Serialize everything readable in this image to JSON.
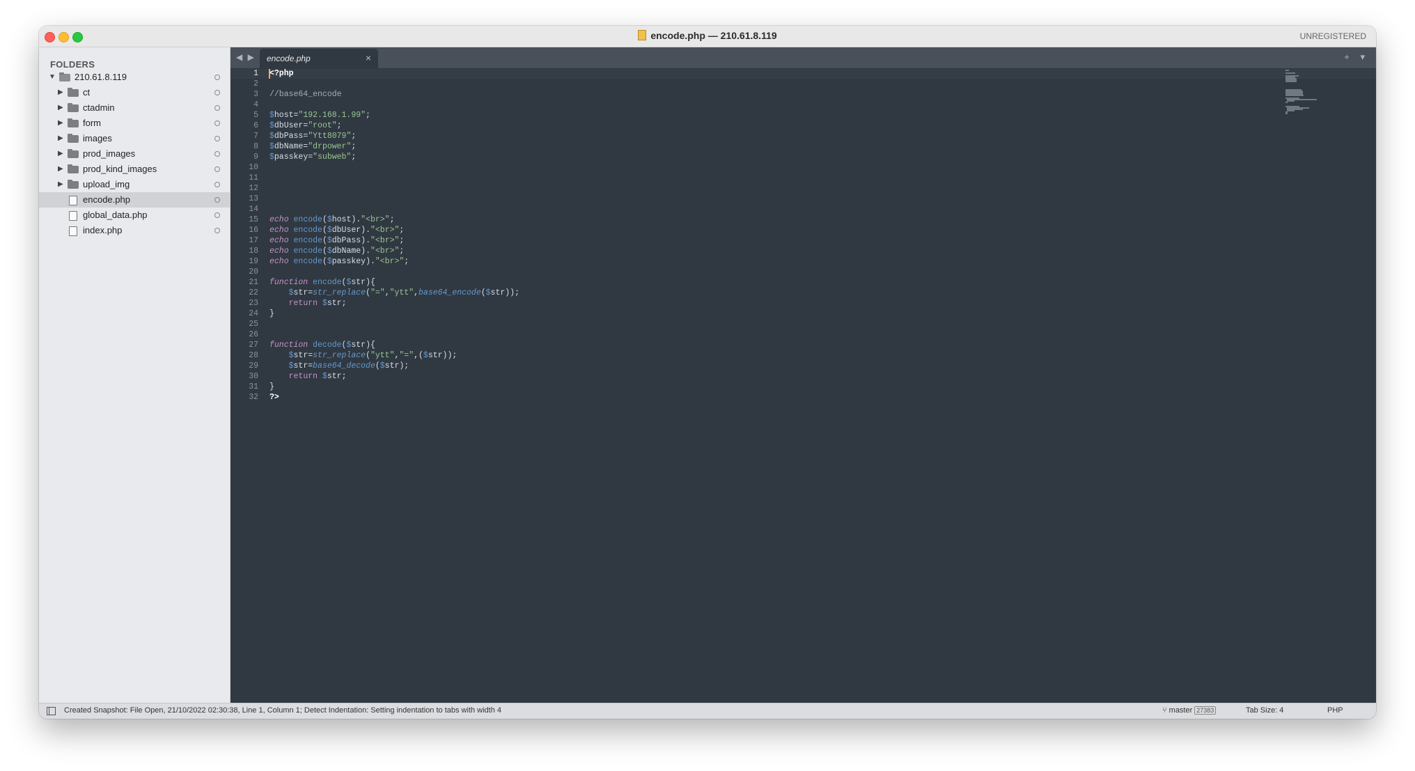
{
  "window": {
    "title": "encode.php — 210.61.8.119",
    "unregistered": "UNREGISTERED"
  },
  "sidebar": {
    "header": "FOLDERS",
    "root": "210.61.8.119",
    "items": [
      {
        "label": "ct",
        "type": "folder"
      },
      {
        "label": "ctadmin",
        "type": "folder"
      },
      {
        "label": "form",
        "type": "folder"
      },
      {
        "label": "images",
        "type": "folder"
      },
      {
        "label": "prod_images",
        "type": "folder"
      },
      {
        "label": "prod_kind_images",
        "type": "folder"
      },
      {
        "label": "upload_img",
        "type": "folder"
      },
      {
        "label": "encode.php",
        "type": "file",
        "selected": true
      },
      {
        "label": "global_data.php",
        "type": "file"
      },
      {
        "label": "index.php",
        "type": "file"
      }
    ]
  },
  "tabs": [
    {
      "label": "encode.php",
      "close": "×"
    }
  ],
  "tabbar": {
    "nav": "◀ ▶",
    "controls": "+ ▾"
  },
  "editor": {
    "current_line": 1,
    "lines": [
      "<?php",
      "",
      "//base64_encode",
      "",
      "$host=\"192.168.1.99\";",
      "$dbUser=\"root\";",
      "$dbPass=\"Ytt8079\";",
      "$dbName=\"drpower\";",
      "$passkey=\"subweb\";",
      "",
      "",
      "",
      "",
      "",
      "echo encode($host).\"<br>\";",
      "echo encode($dbUser).\"<br>\";",
      "echo encode($dbPass).\"<br>\";",
      "echo encode($dbName).\"<br>\";",
      "echo encode($passkey).\"<br>\";",
      "",
      "function encode($str){",
      "    $str=str_replace(\"=\",\"ytt\",base64_encode($str));",
      "    return $str;",
      "}",
      "",
      "",
      "function decode($str){",
      "    $str=str_replace(\"ytt\",\"=\",($str));",
      "    $str=base64_decode($str);",
      "    return $str;",
      "}",
      "?>"
    ]
  },
  "statusbar": {
    "message": "Created Snapshot: File Open, 21/10/2022 02:30:38, Line 1, Column 1; Detect Indentation: Setting indentation to tabs with width 4",
    "branch": "master",
    "branch_badge": "27383",
    "tab_size": "Tab Size: 4",
    "syntax": "PHP"
  },
  "colors": {
    "editor_bg": "#303841",
    "keyword": "#c594c5",
    "function": "#6699cc",
    "string": "#99c794",
    "variable": "#d8dee9",
    "comment": "#a6acb9",
    "cursor": "#f9ae58"
  }
}
